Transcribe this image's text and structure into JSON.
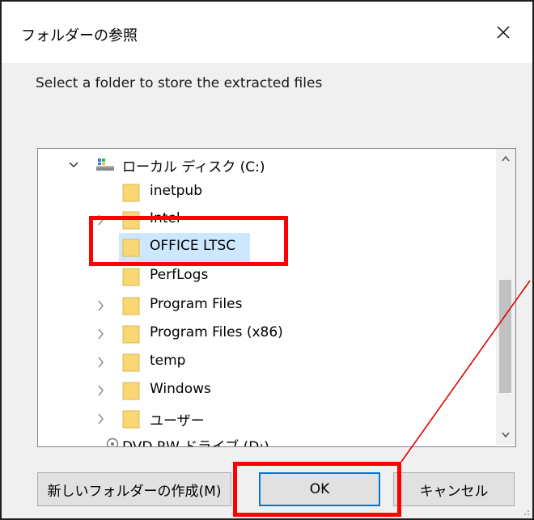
{
  "window": {
    "title": "フォルダーの参照",
    "close_symbol": "✕"
  },
  "instruction": "Select a folder to store the extracted files",
  "tree": {
    "root": {
      "label": "ローカル ディスク (C:)",
      "icon": "drive-icon",
      "expanded": true
    },
    "items": [
      {
        "label": "inetpub",
        "has_children": false,
        "selected": false
      },
      {
        "label": "Intel",
        "has_children": true,
        "selected": false
      },
      {
        "label": "OFFICE LTSC",
        "has_children": false,
        "selected": true
      },
      {
        "label": "PerfLogs",
        "has_children": false,
        "selected": false
      },
      {
        "label": "Program Files",
        "has_children": true,
        "selected": false
      },
      {
        "label": "Program Files (x86)",
        "has_children": true,
        "selected": false
      },
      {
        "label": "temp",
        "has_children": true,
        "selected": false
      },
      {
        "label": "Windows",
        "has_children": true,
        "selected": false
      },
      {
        "label": "ユーザー",
        "has_children": true,
        "selected": false
      }
    ],
    "partial_item": {
      "label": "DVD RW ドライブ (D:)",
      "icon": "disc-drive-icon"
    }
  },
  "buttons": {
    "new_folder": "新しいフォルダーの作成(M)",
    "new_folder_accelerator": "M",
    "ok": "OK",
    "cancel": "キャンセル"
  },
  "colors": {
    "highlight": "#ff0000",
    "selection": "#cce8ff",
    "folder": "#f8d775",
    "focus_border": "#0078d7"
  }
}
